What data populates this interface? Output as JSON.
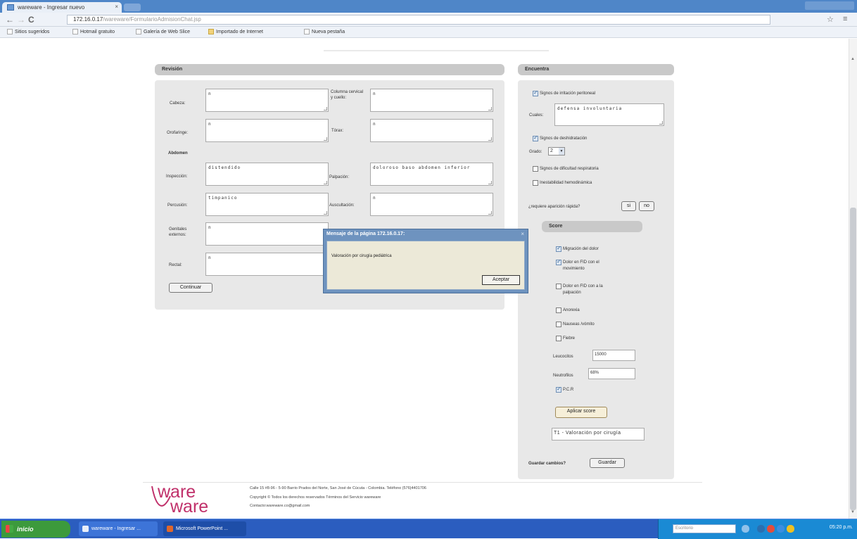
{
  "browser": {
    "tab_title": "wareware - Ingresar nuevo",
    "tab_close": "×",
    "nav_back": "←",
    "nav_forward": "→",
    "nav_reload": "C",
    "url_host": "172.16.0.17",
    "url_path": "/wareware/FormularioAdmisionChat.jsp",
    "star": "☆",
    "menu": "≡",
    "bookmarks": [
      {
        "label": "Sitios sugeridos",
        "folder": false
      },
      {
        "label": "Hotmail gratuito",
        "folder": false
      },
      {
        "label": "Galería de Web Slice",
        "folder": false
      },
      {
        "label": "Importado de Internet",
        "folder": true
      },
      {
        "label": "Nueva pestaña",
        "folder": false
      }
    ]
  },
  "left_panel": {
    "header": "Revisión",
    "fields": {
      "cabeza_label": "Cabeza:",
      "cabeza_value": "n",
      "cuello_label": "Columna cervical y cuello:",
      "cuello_value": "n",
      "orofaringe_label": "Orofaringe:",
      "orofaringe_value": "n",
      "torax_label": "Tórax:",
      "torax_value": "n",
      "abdomen_heading": "Abdomen",
      "inspeccion_label": "Inspección:",
      "inspeccion_value": "distendido",
      "palpacion_label": "Palpación:",
      "palpacion_value": "doloroso baso abdomen inferior",
      "percusion_label": "Percusión:",
      "percusion_value": "timpanico",
      "auscultacion_label": "Auscultación:",
      "auscultacion_value": "n",
      "genitales_label": "Genitales externos:",
      "genitales_value": "n",
      "rectal_label": "Rectal:",
      "rectal_value": "n"
    },
    "continue_button": "Continuar"
  },
  "right_panel": {
    "header": "Encuentra",
    "chk_irritacion": "Signos de irritación peritoneal",
    "cuales_label": "Cuales:",
    "cuales_value": "defensa involuntaria",
    "chk_deshidratacion": "Signos de deshidratación",
    "grado_label": "Grado:",
    "grado_value": "2",
    "chk_respiratoria": "Signos de dificultad respiratoria",
    "chk_hemodinamica": "Inestabilidad hemodinámica",
    "question": "¿requiere aparición rápida?",
    "si_button": "si",
    "no_button": "no",
    "score_header": "Score",
    "score_items": {
      "migracion": "Migración del dolor",
      "fid_movimiento": "Dolor en FID con el movimiento",
      "fid_palpacion": "Dolor en FID con a la palpación",
      "anorexia": "Anorexia",
      "nauseas": "Nauseas /vómito",
      "fiebre": "Fiebre"
    },
    "leucocitos_label": "Leucocitos",
    "leucocitos_value": "15000",
    "neutrofilos_label": "Neutrofilos",
    "neutrofilos_value": "68%",
    "pcr_label": "P.C.R",
    "apply_score_button": "Aplicar score",
    "score_result": "T1 - Valoración por cirugía",
    "save_question": "Guardar cambios?",
    "save_button": "Guardar"
  },
  "modal": {
    "title": "Mensaje de la página 172.16.0.17:",
    "close": "×",
    "message": "Valoración por cirugía pediátrica",
    "ok_button": "Aceptar"
  },
  "footer": {
    "logo_top": "ware",
    "logo_bottom": "ware",
    "line1": "Calle 15 #8-96 - 5-90 Barrio Prados del Norte, San José de Cúcuta - Colombia. Teléfono (576)4401706",
    "line2": "Copyright © Todos los derechos reservados Términos del Servicio wareware",
    "line3": "Contacto:wareware.co@gmail.com"
  },
  "taskbar": {
    "start_label": "inicio",
    "tasks": [
      "wareware - Ingresar ...",
      "Microsoft PowerPoint ..."
    ],
    "search_placeholder": "Escritorio",
    "clock": "05:20 p.m."
  },
  "colors": {
    "tabstrip": "#4f86c8",
    "panel_bg": "#e8e8e8",
    "panel_header": "#c9c9c9",
    "modal_title": "#6e93bf",
    "taskbar": "#2b5dbf",
    "logo": "#c0306a"
  }
}
